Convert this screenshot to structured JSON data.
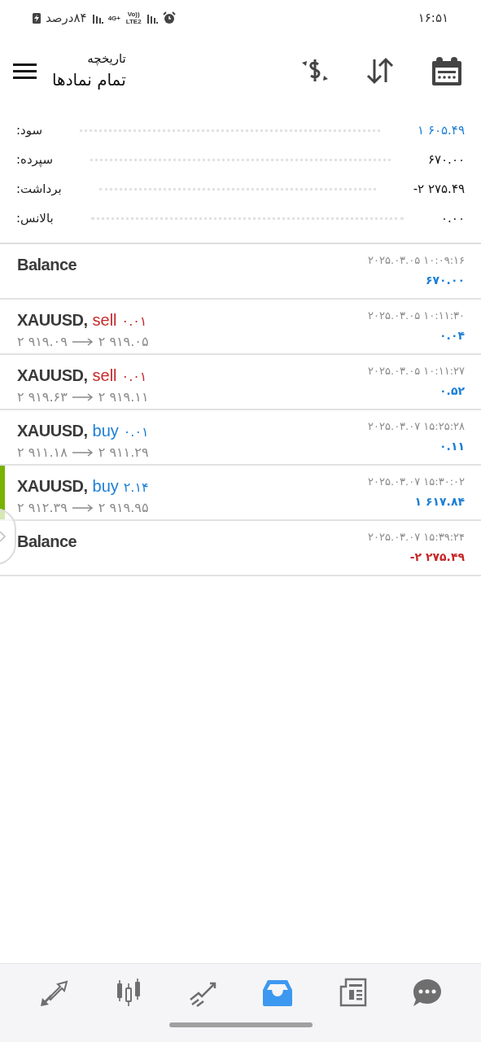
{
  "status_bar": {
    "time": "۱۶:۵۱",
    "network": [
      "4G+",
      "Vo))",
      "LTE2"
    ],
    "battery": "۸۴درصد"
  },
  "header": {
    "subtitle": "تاریخچه",
    "title": "تمام نمادها"
  },
  "summary": [
    {
      "label": "سود:",
      "value": "۱ ۶۰۵.۴۹",
      "color": "#1c7fd6"
    },
    {
      "label": "سپرده:",
      "value": "۶۷۰.۰۰",
      "color": "#111111"
    },
    {
      "label": "برداشت:",
      "value": "-۲ ۲۷۵.۴۹",
      "color": "#111111"
    },
    {
      "label": "بالانس:",
      "value": "۰.۰۰",
      "color": "#111111"
    }
  ],
  "rows": [
    {
      "kind": "balance",
      "title": "Balance",
      "time": "۲۰۲۵.۰۳.۰۵ ۱۰:۰۹:۱۶",
      "amount": "۶۷۰.۰۰",
      "negative": false,
      "marked": false
    },
    {
      "kind": "trade",
      "title": "XAUUSD,",
      "side": "sell",
      "lot": "۰.۰۱",
      "open": "۲ ۹۱۹.۰۹",
      "close": "۲ ۹۱۹.۰۵",
      "time": "۲۰۲۵.۰۳.۰۵ ۱۰:۱۱:۳۰",
      "amount": "۰.۰۴",
      "negative": false,
      "marked": false
    },
    {
      "kind": "trade",
      "title": "XAUUSD,",
      "side": "sell",
      "lot": "۰.۰۱",
      "open": "۲ ۹۱۹.۶۳",
      "close": "۲ ۹۱۹.۱۱",
      "time": "۲۰۲۵.۰۳.۰۵ ۱۰:۱۱:۲۷",
      "amount": "۰.۵۲",
      "negative": false,
      "marked": false
    },
    {
      "kind": "trade",
      "title": "XAUUSD,",
      "side": "buy",
      "lot": "۰.۰۱",
      "open": "۲ ۹۱۱.۱۸",
      "close": "۲ ۹۱۱.۲۹",
      "time": "۲۰۲۵.۰۳.۰۷ ۱۵:۲۵:۲۸",
      "amount": "۰.۱۱",
      "negative": false,
      "marked": false
    },
    {
      "kind": "trade",
      "title": "XAUUSD,",
      "side": "buy",
      "lot": "۲.۱۴",
      "open": "۲ ۹۱۲.۳۹",
      "close": "۲ ۹۱۹.۹۵",
      "time": "۲۰۲۵.۰۳.۰۷ ۱۵:۳۰:۰۲",
      "amount": "۱ ۶۱۷.۸۴",
      "negative": false,
      "marked": true
    },
    {
      "kind": "balance",
      "title": "Balance",
      "time": "۲۰۲۵.۰۳.۰۷ ۱۵:۳۹:۲۴",
      "amount": "-۲ ۲۷۵.۴۹",
      "negative": true,
      "marked": false
    }
  ],
  "bottom_nav": [
    {
      "kind": "trade",
      "selected": false
    },
    {
      "kind": "quotes",
      "selected": false
    },
    {
      "kind": "chart",
      "selected": false
    },
    {
      "kind": "history",
      "selected": true
    },
    {
      "kind": "news",
      "selected": false
    },
    {
      "kind": "messages",
      "selected": false
    }
  ]
}
